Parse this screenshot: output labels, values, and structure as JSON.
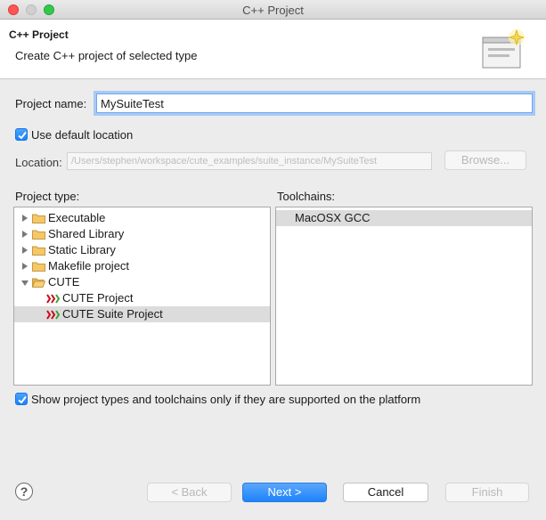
{
  "window": {
    "title": "C++ Project"
  },
  "header": {
    "title": "C++ Project",
    "subtitle": "Create C++ project of selected type",
    "icon": "wizard-banner-icon"
  },
  "project_name": {
    "label": "Project name:",
    "value": "MySuiteTest"
  },
  "default_location": {
    "label": "Use default location",
    "checked": true
  },
  "location": {
    "label": "Location:",
    "value": "/Users/stephen/workspace/cute_examples/suite_instance/MySuiteTest",
    "browse_label": "Browse..."
  },
  "project_type": {
    "label": "Project type:",
    "items": [
      {
        "label": "Executable",
        "kind": "folder",
        "expanded": false
      },
      {
        "label": "Shared Library",
        "kind": "folder",
        "expanded": false
      },
      {
        "label": "Static Library",
        "kind": "folder",
        "expanded": false
      },
      {
        "label": "Makefile project",
        "kind": "folder",
        "expanded": false
      },
      {
        "label": "CUTE",
        "kind": "folder",
        "expanded": true
      },
      {
        "label": "CUTE Project",
        "kind": "cute"
      },
      {
        "label": "CUTE Suite Project",
        "kind": "cute",
        "selected": true
      }
    ]
  },
  "toolchains": {
    "label": "Toolchains:",
    "items": [
      {
        "label": "MacOSX GCC",
        "selected": true
      }
    ]
  },
  "show_supported": {
    "label": "Show project types and toolchains only if they are supported on the platform",
    "checked": true
  },
  "buttons": {
    "help": "?",
    "back": "< Back",
    "next": "Next >",
    "cancel": "Cancel",
    "finish": "Finish"
  },
  "colors": {
    "accent": "#1d83fb",
    "selection": "#dcdcdc",
    "cute_red": "#d0021b",
    "cute_green": "#3aa52a"
  }
}
